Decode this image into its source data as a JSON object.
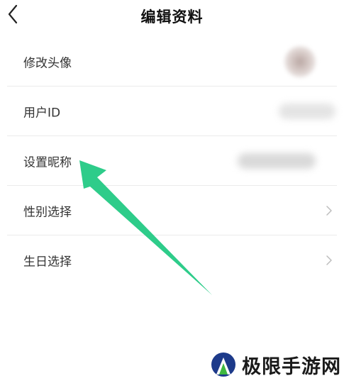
{
  "header": {
    "title": "编辑资料",
    "back_icon": "chevron-left-icon"
  },
  "rows": [
    {
      "label": "修改头像",
      "value_type": "avatar"
    },
    {
      "label": "用户ID",
      "value_type": "blurred-text"
    },
    {
      "label": "设置昵称",
      "value_type": "blurred-text"
    },
    {
      "label": "性别选择",
      "value_type": "chevron"
    },
    {
      "label": "生日选择",
      "value_type": "chevron"
    }
  ],
  "annotation": {
    "arrow_color": "#2ecc8a",
    "points_to": "设置昵称"
  },
  "watermark": {
    "text": "极限手游网",
    "logo_colors": [
      "#1d3a8a",
      "#3fb83f"
    ]
  }
}
